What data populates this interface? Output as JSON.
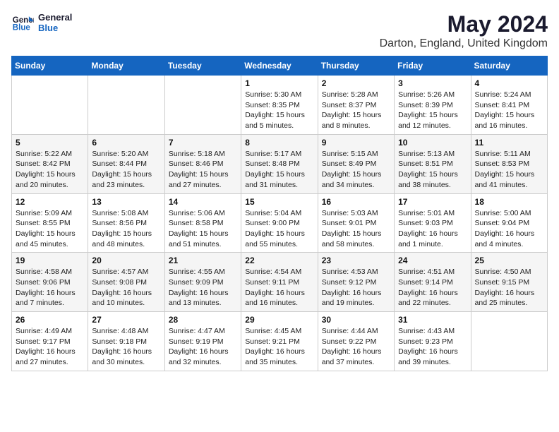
{
  "logo": {
    "line1": "General",
    "line2": "Blue"
  },
  "title": "May 2024",
  "location": "Darton, England, United Kingdom",
  "weekdays": [
    "Sunday",
    "Monday",
    "Tuesday",
    "Wednesday",
    "Thursday",
    "Friday",
    "Saturday"
  ],
  "weeks": [
    [
      {
        "day": "",
        "info": ""
      },
      {
        "day": "",
        "info": ""
      },
      {
        "day": "",
        "info": ""
      },
      {
        "day": "1",
        "info": "Sunrise: 5:30 AM\nSunset: 8:35 PM\nDaylight: 15 hours\nand 5 minutes."
      },
      {
        "day": "2",
        "info": "Sunrise: 5:28 AM\nSunset: 8:37 PM\nDaylight: 15 hours\nand 8 minutes."
      },
      {
        "day": "3",
        "info": "Sunrise: 5:26 AM\nSunset: 8:39 PM\nDaylight: 15 hours\nand 12 minutes."
      },
      {
        "day": "4",
        "info": "Sunrise: 5:24 AM\nSunset: 8:41 PM\nDaylight: 15 hours\nand 16 minutes."
      }
    ],
    [
      {
        "day": "5",
        "info": "Sunrise: 5:22 AM\nSunset: 8:42 PM\nDaylight: 15 hours\nand 20 minutes."
      },
      {
        "day": "6",
        "info": "Sunrise: 5:20 AM\nSunset: 8:44 PM\nDaylight: 15 hours\nand 23 minutes."
      },
      {
        "day": "7",
        "info": "Sunrise: 5:18 AM\nSunset: 8:46 PM\nDaylight: 15 hours\nand 27 minutes."
      },
      {
        "day": "8",
        "info": "Sunrise: 5:17 AM\nSunset: 8:48 PM\nDaylight: 15 hours\nand 31 minutes."
      },
      {
        "day": "9",
        "info": "Sunrise: 5:15 AM\nSunset: 8:49 PM\nDaylight: 15 hours\nand 34 minutes."
      },
      {
        "day": "10",
        "info": "Sunrise: 5:13 AM\nSunset: 8:51 PM\nDaylight: 15 hours\nand 38 minutes."
      },
      {
        "day": "11",
        "info": "Sunrise: 5:11 AM\nSunset: 8:53 PM\nDaylight: 15 hours\nand 41 minutes."
      }
    ],
    [
      {
        "day": "12",
        "info": "Sunrise: 5:09 AM\nSunset: 8:55 PM\nDaylight: 15 hours\nand 45 minutes."
      },
      {
        "day": "13",
        "info": "Sunrise: 5:08 AM\nSunset: 8:56 PM\nDaylight: 15 hours\nand 48 minutes."
      },
      {
        "day": "14",
        "info": "Sunrise: 5:06 AM\nSunset: 8:58 PM\nDaylight: 15 hours\nand 51 minutes."
      },
      {
        "day": "15",
        "info": "Sunrise: 5:04 AM\nSunset: 9:00 PM\nDaylight: 15 hours\nand 55 minutes."
      },
      {
        "day": "16",
        "info": "Sunrise: 5:03 AM\nSunset: 9:01 PM\nDaylight: 15 hours\nand 58 minutes."
      },
      {
        "day": "17",
        "info": "Sunrise: 5:01 AM\nSunset: 9:03 PM\nDaylight: 16 hours\nand 1 minute."
      },
      {
        "day": "18",
        "info": "Sunrise: 5:00 AM\nSunset: 9:04 PM\nDaylight: 16 hours\nand 4 minutes."
      }
    ],
    [
      {
        "day": "19",
        "info": "Sunrise: 4:58 AM\nSunset: 9:06 PM\nDaylight: 16 hours\nand 7 minutes."
      },
      {
        "day": "20",
        "info": "Sunrise: 4:57 AM\nSunset: 9:08 PM\nDaylight: 16 hours\nand 10 minutes."
      },
      {
        "day": "21",
        "info": "Sunrise: 4:55 AM\nSunset: 9:09 PM\nDaylight: 16 hours\nand 13 minutes."
      },
      {
        "day": "22",
        "info": "Sunrise: 4:54 AM\nSunset: 9:11 PM\nDaylight: 16 hours\nand 16 minutes."
      },
      {
        "day": "23",
        "info": "Sunrise: 4:53 AM\nSunset: 9:12 PM\nDaylight: 16 hours\nand 19 minutes."
      },
      {
        "day": "24",
        "info": "Sunrise: 4:51 AM\nSunset: 9:14 PM\nDaylight: 16 hours\nand 22 minutes."
      },
      {
        "day": "25",
        "info": "Sunrise: 4:50 AM\nSunset: 9:15 PM\nDaylight: 16 hours\nand 25 minutes."
      }
    ],
    [
      {
        "day": "26",
        "info": "Sunrise: 4:49 AM\nSunset: 9:17 PM\nDaylight: 16 hours\nand 27 minutes."
      },
      {
        "day": "27",
        "info": "Sunrise: 4:48 AM\nSunset: 9:18 PM\nDaylight: 16 hours\nand 30 minutes."
      },
      {
        "day": "28",
        "info": "Sunrise: 4:47 AM\nSunset: 9:19 PM\nDaylight: 16 hours\nand 32 minutes."
      },
      {
        "day": "29",
        "info": "Sunrise: 4:45 AM\nSunset: 9:21 PM\nDaylight: 16 hours\nand 35 minutes."
      },
      {
        "day": "30",
        "info": "Sunrise: 4:44 AM\nSunset: 9:22 PM\nDaylight: 16 hours\nand 37 minutes."
      },
      {
        "day": "31",
        "info": "Sunrise: 4:43 AM\nSunset: 9:23 PM\nDaylight: 16 hours\nand 39 minutes."
      },
      {
        "day": "",
        "info": ""
      }
    ]
  ]
}
